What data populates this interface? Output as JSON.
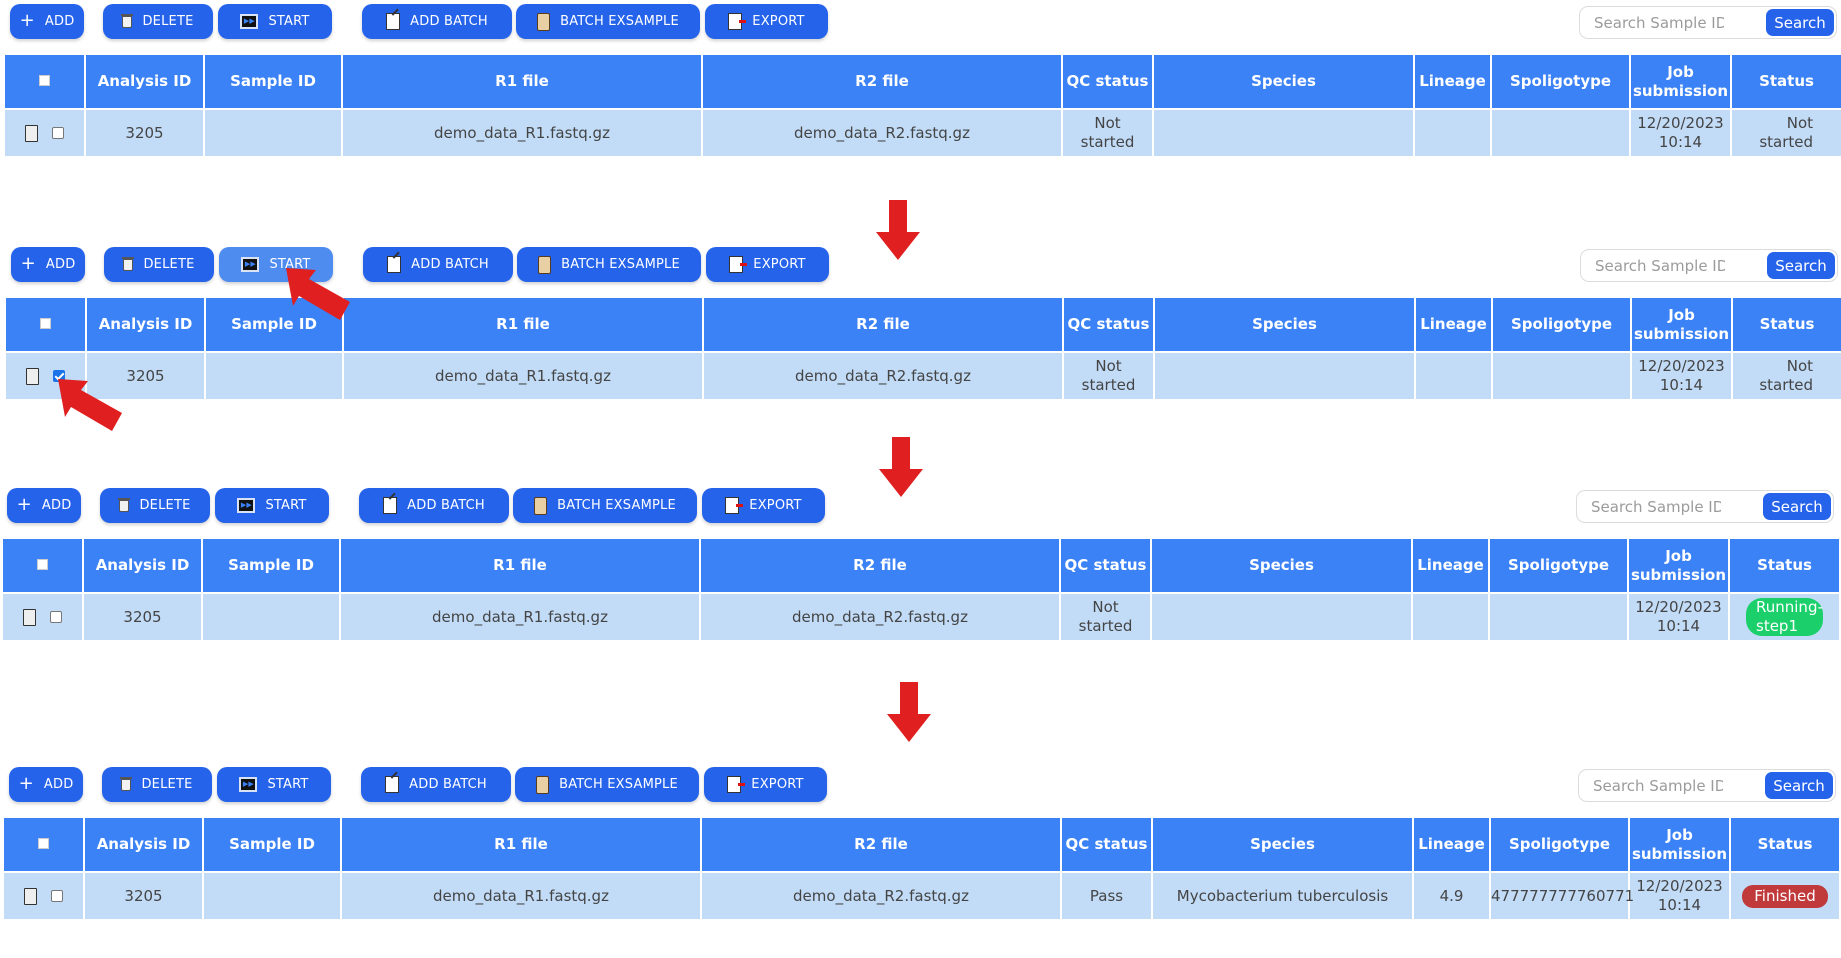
{
  "toolbar": {
    "add": "ADD",
    "delete": "DELETE",
    "start": "START",
    "add_batch": "ADD BATCH",
    "batch_example": "BATCH EXSAMPLE",
    "export": "EXPORT"
  },
  "search": {
    "placeholder": "Search Sample ID",
    "button": "Search"
  },
  "table": {
    "headers": {
      "analysis_id": "Analysis ID",
      "sample_id": "Sample ID",
      "r1": "R1 file",
      "r2": "R2 file",
      "qc": "QC status",
      "species": "Species",
      "lineage": "Lineage",
      "spoligotype": "Spoligotype",
      "job_l1": "Job",
      "job_l2": "submission",
      "status": "Status"
    }
  },
  "rows": [
    {
      "checked": false,
      "analysis_id": "3205",
      "sample_id": "",
      "r1": "demo_data_R1.fastq.gz",
      "r2": "demo_data_R2.fastq.gz",
      "qc_l1": "Not",
      "qc_l2": "started",
      "species": "",
      "lineage": "",
      "spoligotype": "",
      "job_date": "12/20/2023",
      "job_time": "10:14",
      "status_l1": "Not",
      "status_l2": "started"
    },
    {
      "checked": true,
      "analysis_id": "3205",
      "sample_id": "",
      "r1": "demo_data_R1.fastq.gz",
      "r2": "demo_data_R2.fastq.gz",
      "qc_l1": "Not",
      "qc_l2": "started",
      "species": "",
      "lineage": "",
      "spoligotype": "",
      "job_date": "12/20/2023",
      "job_time": "10:14",
      "status_l1": "Not",
      "status_l2": "started"
    },
    {
      "checked": false,
      "analysis_id": "3205",
      "sample_id": "",
      "r1": "demo_data_R1.fastq.gz",
      "r2": "demo_data_R2.fastq.gz",
      "qc_l1": "Not",
      "qc_l2": "started",
      "species": "",
      "lineage": "",
      "spoligotype": "",
      "job_date": "12/20/2023",
      "job_time": "10:14",
      "status_badge": "Running-step1"
    },
    {
      "checked": false,
      "analysis_id": "3205",
      "sample_id": "",
      "r1": "demo_data_R1.fastq.gz",
      "r2": "demo_data_R2.fastq.gz",
      "qc_l1": "Pass",
      "qc_l2": "",
      "species": "Mycobacterium tuberculosis",
      "lineage": "4.9",
      "spoligotype": "477777777760771",
      "job_date": "12/20/2023",
      "job_time": "10:14",
      "status_badge": "Finished"
    }
  ],
  "colors": {
    "primary": "#2563eb",
    "header": "#3b82f6",
    "row": "#c2dcf8",
    "running": "#1bcf6b",
    "finished": "#c0393b",
    "arrow": "#e02020"
  }
}
